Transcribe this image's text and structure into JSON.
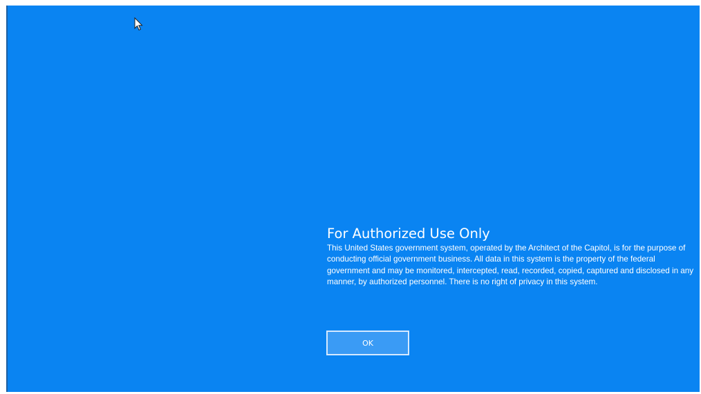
{
  "notice": {
    "title": "For Authorized Use Only",
    "body": "This United States government system, operated by the Architect of the Capitol, is for the purpose of conducting official government business. All data in this system is the property of the federal government and may be monitored, intercepted, read, recorded, copied, captured and disclosed in any manner, by authorized personnel. There is no right of privacy in this system."
  },
  "actions": {
    "ok_label": "OK"
  },
  "colors": {
    "background": "#0a84f2",
    "button_fill": "#3a9bf5",
    "button_border": "#d6eaff",
    "text": "#ffffff"
  },
  "icons": {
    "pointer": "mouse-pointer-icon"
  }
}
